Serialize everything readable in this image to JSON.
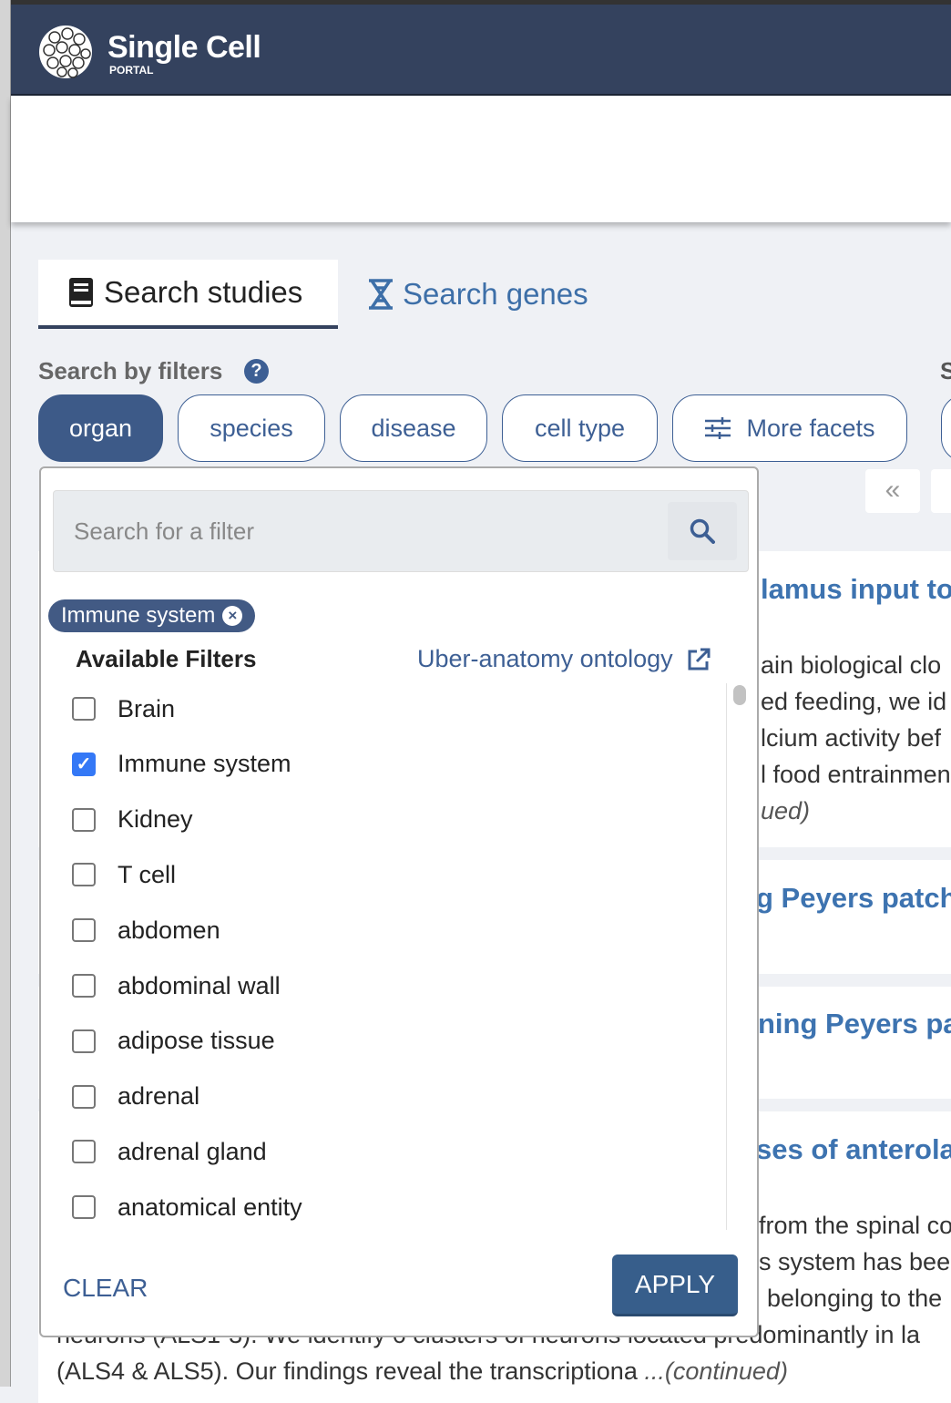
{
  "header": {
    "logo_title": "Single Cell",
    "logo_subtitle": "PORTAL"
  },
  "tabs": [
    {
      "label": "Search studies",
      "icon": "book-icon",
      "active": true
    },
    {
      "label": "Search genes",
      "icon": "hourglass-dna-icon",
      "active": false
    }
  ],
  "filters_label": "Search by filters",
  "next_section_cut": "S",
  "facets": [
    {
      "label": "organ",
      "active": true
    },
    {
      "label": "species"
    },
    {
      "label": "disease"
    },
    {
      "label": "cell type"
    },
    {
      "label": "More facets",
      "icon": "sliders-icon"
    }
  ],
  "pagination": {
    "first": "«"
  },
  "results": [
    {
      "title_fragment": "lamus input to",
      "text_fragments": [
        "ain biological clo",
        "ed feeding, we id",
        "lcium activity bef",
        "l food entrainmen"
      ],
      "continued_fragment": "ued)"
    },
    {
      "title_fragment": "g Peyers patch"
    },
    {
      "title_fragment": "ning Peyers pa"
    },
    {
      "title_fragment": "ses of anterolat",
      "text_fragments": [
        "from the spinal co",
        "s system has bee",
        "belonging to the"
      ],
      "line4": "neurons (ALS1-3). We identify 6 clusters of neurons located predominantly in la",
      "line5": "(ALS4 & ALS5). Our findings reveal the transcriptiona",
      "continued": "...(continued)"
    }
  ],
  "panel": {
    "search_placeholder": "Search for a filter",
    "selected_tag": "Immune system",
    "available_label": "Available Filters",
    "ontology_link": "Uber-anatomy ontology",
    "options": [
      {
        "label": "Brain",
        "checked": false
      },
      {
        "label": "Immune system",
        "checked": true
      },
      {
        "label": "Kidney",
        "checked": false
      },
      {
        "label": "T cell",
        "checked": false
      },
      {
        "label": "abdomen",
        "checked": false
      },
      {
        "label": "abdominal wall",
        "checked": false
      },
      {
        "label": "adipose tissue",
        "checked": false
      },
      {
        "label": "adrenal",
        "checked": false
      },
      {
        "label": "adrenal gland",
        "checked": false
      },
      {
        "label": "anatomical entity",
        "checked": false
      }
    ],
    "clear_label": "CLEAR",
    "apply_label": "APPLY"
  },
  "colors": {
    "header": "#34425e",
    "accent": "#3d5f94",
    "link": "#3d73b0",
    "checkbox": "#3478f6"
  }
}
